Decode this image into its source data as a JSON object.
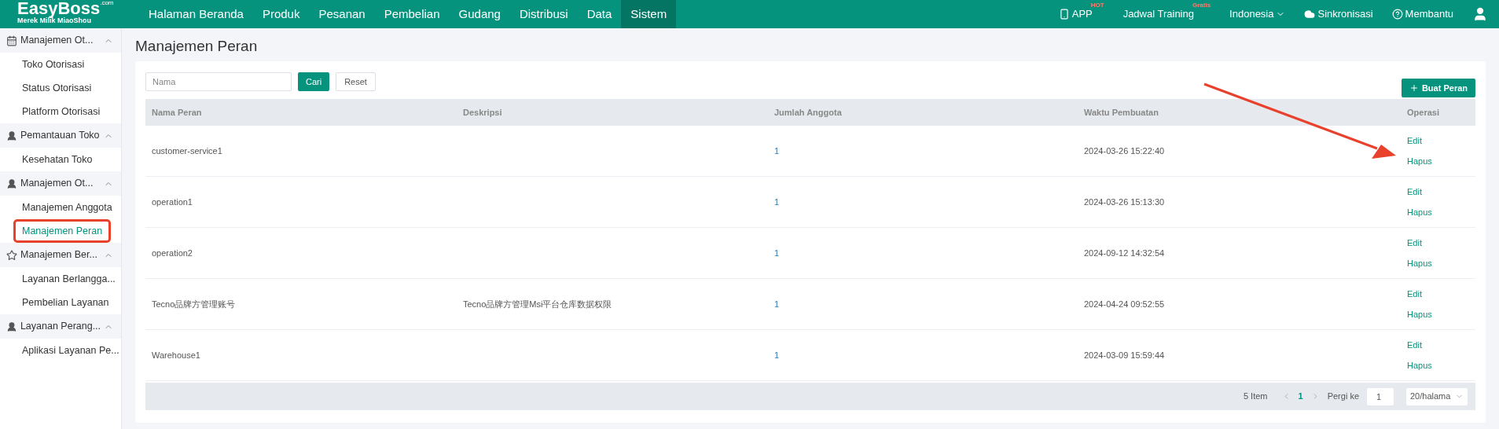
{
  "header": {
    "logo": "EasyBoss",
    "logo_suffix": ".com",
    "logo_tagline": "Merek Milik MiaoShou",
    "nav": [
      {
        "label": "Halaman Beranda",
        "selected": false
      },
      {
        "label": "Produk",
        "selected": false
      },
      {
        "label": "Pesanan",
        "selected": false
      },
      {
        "label": "Pembelian",
        "selected": false
      },
      {
        "label": "Gudang",
        "selected": false
      },
      {
        "label": "Distribusi",
        "selected": false
      },
      {
        "label": "Data",
        "selected": false
      },
      {
        "label": "Sistem",
        "selected": true
      }
    ],
    "right": [
      {
        "kind": "app",
        "label": "APP",
        "badge": "HOT"
      },
      {
        "kind": "training",
        "label": "Jadwal Training",
        "badge": "Gratis"
      },
      {
        "kind": "language",
        "label": "Indonesia"
      },
      {
        "kind": "sync",
        "label": "Sinkronisasi"
      },
      {
        "kind": "help",
        "label": "Membantu"
      }
    ]
  },
  "sidebar": {
    "groups": [
      {
        "label": "Manajemen Ot...",
        "expanded": true,
        "children": [
          {
            "label": "Toko Otorisasi",
            "selected": false,
            "annotated": false
          },
          {
            "label": "Status Otorisasi",
            "selected": false,
            "annotated": false
          },
          {
            "label": "Platform Otorisasi",
            "selected": false,
            "annotated": false
          }
        ]
      },
      {
        "label": "Pemantauan Toko",
        "expanded": true,
        "children": [
          {
            "label": "Kesehatan Toko",
            "selected": false,
            "annotated": false
          }
        ]
      },
      {
        "label": "Manajemen Ot...",
        "expanded": true,
        "children": [
          {
            "label": "Manajemen Anggota",
            "selected": false,
            "annotated": false
          },
          {
            "label": "Manajemen Peran",
            "selected": true,
            "annotated": true
          }
        ]
      },
      {
        "label": "Manajemen Ber...",
        "expanded": true,
        "children": [
          {
            "label": "Layanan Berlangga...",
            "selected": false,
            "annotated": false
          },
          {
            "label": "Pembelian Layanan",
            "selected": false,
            "annotated": false
          }
        ]
      },
      {
        "label": "Layanan Perang...",
        "expanded": true,
        "children": [
          {
            "label": "Aplikasi Layanan Pe...",
            "selected": false,
            "annotated": false
          }
        ]
      }
    ]
  },
  "page_title": "Manajemen Peran",
  "search": {
    "placeholder": "Nama"
  },
  "buttons": {
    "search": "Cari",
    "reset": "Reset",
    "create": "Buat Peran"
  },
  "table": {
    "columns": [
      "Nama Peran",
      "Deskripsi",
      "Jumlah Anggota",
      "Waktu Pembuatan",
      "Operasi"
    ],
    "rows": [
      {
        "name": "customer-service1",
        "description": "",
        "members": "1",
        "created": "2024-03-26 15:22:40",
        "actions": [
          "Edit",
          "Hapus"
        ]
      },
      {
        "name": "operation1",
        "description": "",
        "members": "1",
        "created": "2024-03-26 15:13:30",
        "actions": [
          "Edit",
          "Hapus"
        ]
      },
      {
        "name": "operation2",
        "description": "",
        "members": "1",
        "created": "2024-09-12 14:32:54",
        "actions": [
          "Edit",
          "Hapus"
        ]
      },
      {
        "name": "Tecno品牌方管理账号",
        "description": "Tecno品牌方管理Msi平台仓库数据权限",
        "members": "1",
        "created": "2024-04-24 09:52:55",
        "actions": [
          "Edit",
          "Hapus"
        ]
      },
      {
        "name": "Warehouse1",
        "description": "",
        "members": "1",
        "created": "2024-03-09 15:59:44",
        "actions": [
          "Edit",
          "Hapus"
        ]
      }
    ]
  },
  "pagination": {
    "total": "5 Item",
    "pages": [
      {
        "label": "1",
        "selected": true
      }
    ],
    "goto_label": "Pergi ke",
    "goto_value": "1",
    "page_size": "20/halama"
  }
}
